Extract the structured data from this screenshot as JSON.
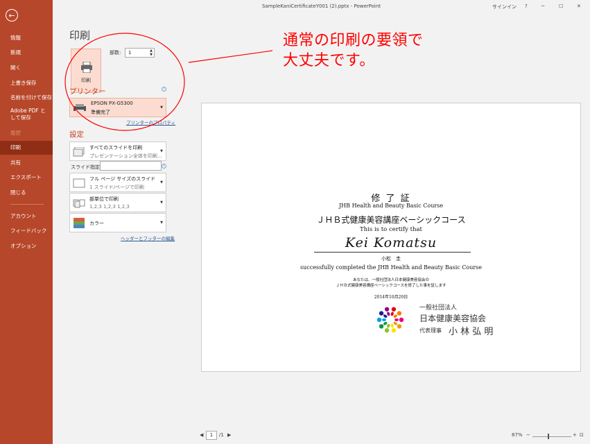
{
  "window": {
    "title": "SampleKaniCertificateY001 (2).pptx - PowerPoint",
    "signin": "サインイン",
    "help": "?",
    "minimize": "─",
    "maximize": "☐",
    "close": "✕"
  },
  "sidebar": {
    "back_icon": "←",
    "items": [
      "情報",
      "新規",
      "開く",
      "上書き保存",
      "名前を付けて保存",
      "Adobe PDF として保存",
      "履歴",
      "印刷",
      "共有",
      "エクスポート",
      "閉じる",
      "アカウント",
      "フィードバック",
      "オプション"
    ],
    "active_index": 7
  },
  "print": {
    "heading": "印刷",
    "button_label": "印刷",
    "copies_label": "部数:",
    "copies_value": "1",
    "spin_up": "▲",
    "spin_down": "▼"
  },
  "printer": {
    "section_title": "プリンター",
    "name": "EPSON PX-G5300",
    "status": "準備完了",
    "properties_link": "プリンターのプロパティ"
  },
  "settings": {
    "section_title": "設定",
    "slides_range": {
      "line1": "すべてのスライドを印刷",
      "line2": "プレゼンテーション全体を印刷…"
    },
    "slides_label": "スライド指定:",
    "slides_value": "",
    "layout": {
      "line1": "フル ページ サイズのスライド",
      "line2": "1 スライド/ページで印刷"
    },
    "collate": {
      "line1": "部単位で印刷",
      "line2": "1,2,3    1,2,3    1,2,3"
    },
    "color": {
      "line1": "カラー"
    },
    "header_footer_link": "ヘッダーとフッターの編集",
    "dropdown_arrow": "▼"
  },
  "annotation": {
    "line1": "通常の印刷の要領で",
    "line2": "大丈夫です。"
  },
  "certificate": {
    "title": "修 了 証",
    "course_en": "JHB Health and Beauty Basic Course",
    "course_jp": "ＪＨＢ式健康美容講座ベーシックコース",
    "certify": "This is to certify that",
    "name_en": "Kei Komatsu",
    "name_jp": "小松　圭",
    "completed": "successfully completed the JHB Health and Beauty Basic Course",
    "body_jp1": "あなたは、一般社団法人日本健康美容協会の",
    "body_jp2": "ＪＨＢ式健康美容講座ベーシックコースを修了した事を証します",
    "date": "2014年10月20日",
    "org_type": "一般社団法人",
    "org_name": "日本健康美容協会",
    "rep_title": "代表理事",
    "rep_name": "小 林 弘 明",
    "logo_colors": [
      "#e4007f",
      "#f39800",
      "#ffe100",
      "#8fc31f",
      "#009944",
      "#00a0e9",
      "#1d2088",
      "#920783",
      "#e60012",
      "#f08300"
    ]
  },
  "statusbar": {
    "prev": "◀",
    "page_current": "1",
    "page_total": "/1",
    "next": "▶",
    "zoom": "87%",
    "zoom_out": "−",
    "zoom_in": "+",
    "fit_icon": "⊡"
  }
}
